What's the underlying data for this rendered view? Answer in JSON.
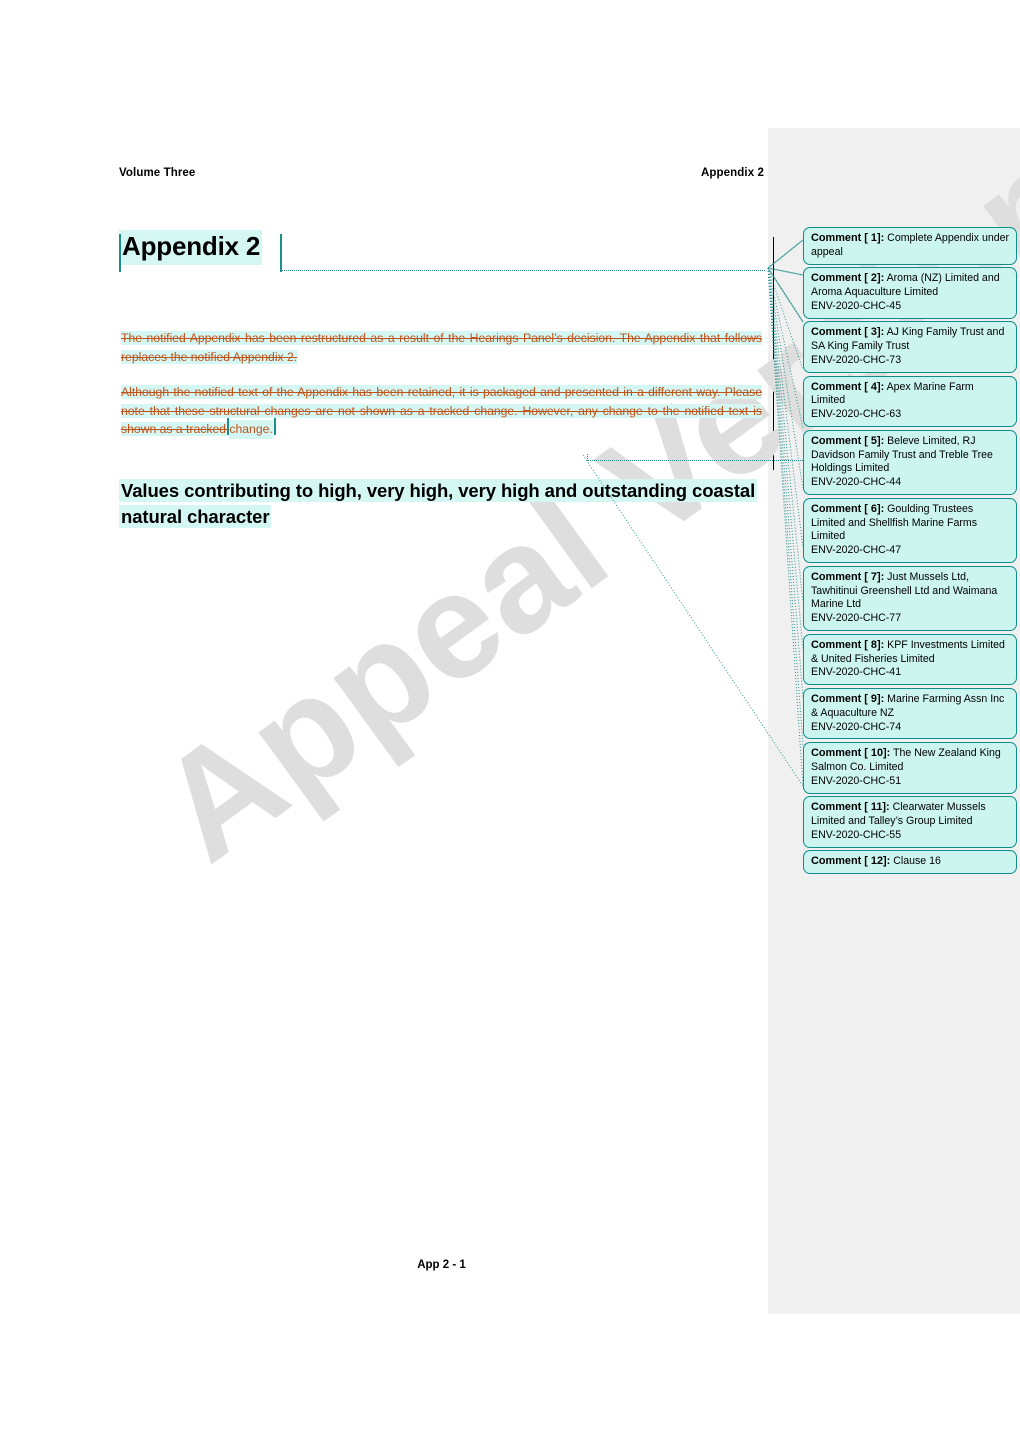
{
  "document": {
    "header": {
      "left": "Volume Three",
      "right": "Appendix 2"
    },
    "title": "Appendix 2",
    "paragraphs": [
      "The notified Appendix has been restructured as a result of the Hearings Panel’s decision. The Appendix that follows replaces the notified Appendix 2.",
      "Although the notified text of the Appendix has been retained, it is packaged and presented in a different way. Please note that these structural changes are not shown as a tracked change. However, any change to the notified text is shown as a tracked ",
      "change."
    ],
    "section_heading": "Values contributing to high, very high, very high and outstanding coastal natural character",
    "watermark": "Appeal Version",
    "footer": "App 2 - 1"
  },
  "colors": {
    "tracked_change_text": "#c0531a",
    "highlight": "#d5f7f3",
    "comment_fill": "#ccf5f0",
    "comment_border": "#0f8c8c",
    "gutter_background": "#f0f0f0",
    "watermark": "#dedede",
    "connector_line": "#1d8f8a"
  },
  "comments": [
    {
      "label": "Comment [ 1]:",
      "body": "Complete Appendix under appeal",
      "ref": ""
    },
    {
      "label": "Comment [ 2]:",
      "body": "Aroma (NZ) Limited and Aroma Aquaculture Limited",
      "ref": "ENV-2020-CHC-45"
    },
    {
      "label": "Comment [ 3]:",
      "body": "AJ King Family Trust and SA King Family Trust",
      "ref": "ENV-2020-CHC-73"
    },
    {
      "label": "Comment [ 4]:",
      "body": "Apex Marine Farm Limited",
      "ref": "ENV-2020-CHC-63"
    },
    {
      "label": "Comment [ 5]:",
      "body": "Beleve Limited, RJ Davidson Family Trust and Treble Tree Holdings Limited",
      "ref": "ENV-2020-CHC-44"
    },
    {
      "label": "Comment [ 6]:",
      "body": "Goulding Trustees Limited and Shellfish Marine Farms Limited",
      "ref": "ENV-2020-CHC-47"
    },
    {
      "label": "Comment [ 7]:",
      "body": "Just Mussels Ltd, Tawhitinui Greenshell Ltd and Waimana Marine Ltd",
      "ref": "ENV-2020-CHC-77"
    },
    {
      "label": "Comment [ 8]:",
      "body": "KPF Investments Limited & United Fisheries Limited",
      "ref": "ENV-2020-CHC-41"
    },
    {
      "label": "Comment [ 9]:",
      "body": "Marine Farming Assn Inc & Aquaculture NZ",
      "ref": "ENV-2020-CHC-74"
    },
    {
      "label": "Comment [ 10]:",
      "body": "The New Zealand King Salmon Co. Limited",
      "ref": "ENV-2020-CHC-51"
    },
    {
      "label": "Comment [ 11]:",
      "body": "Clearwater Mussels Limited and Talley’s Group Limited",
      "ref": "ENV-2020-CHC-55"
    },
    {
      "label": "Comment [ 12]:",
      "body": "Clause 16",
      "ref": ""
    }
  ]
}
